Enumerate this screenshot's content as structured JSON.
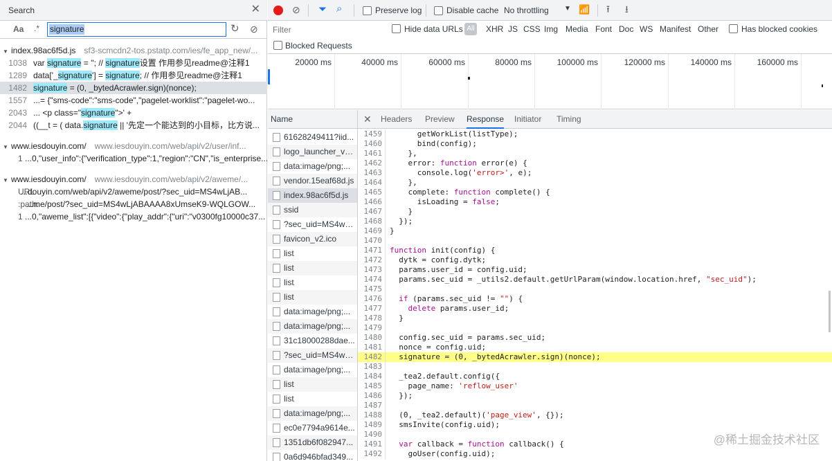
{
  "search_panel": {
    "tab_label": "Search",
    "aa_label": "Aa",
    "regex_label": ".*",
    "query": "signature",
    "results": [
      {
        "file": "index.98ac6f5d.js",
        "path": "sf3-scmcdn2-tos.pstatp.com/ies/fe_app_new/...",
        "lines": [
          {
            "num": "1038",
            "pre": "var ",
            "hl1": "signature",
            "mid": " = ''; // ",
            "hl2": "signature",
            "post": "设置 作用参见readme@注释1"
          },
          {
            "num": "1289",
            "pre": "data['_",
            "hl1": "signature",
            "mid": "'] = ",
            "hl2": "signature",
            "post": "; // 作用参见readme@注释1"
          },
          {
            "num": "1482",
            "pre": "",
            "hl1": "signature",
            "mid": " = (0, _bytedAcrawler.sign)(nonce);",
            "hl2": "",
            "post": ""
          },
          {
            "num": "1557",
            "pre": "...= {\"sms-code\":\"sms-code\",\"pagelet-worklist\":\"pagelet-wo...",
            "hl1": "",
            "mid": "",
            "hl2": "",
            "post": ""
          },
          {
            "num": "2043",
            "pre": "...         <p class=\"",
            "hl1": "signature",
            "mid": "\">' +",
            "hl2": "",
            "post": ""
          },
          {
            "num": "2044",
            "pre": "((__t = ( data.",
            "hl1": "signature",
            "mid": " || '先定一个能达到的小目标，比方说...",
            "hl2": "",
            "post": ""
          }
        ]
      },
      {
        "file": "www.iesdouyin.com/",
        "path": "www.iesdouyin.com/web/api/v2/user/inf...",
        "lines": [
          {
            "num": "1",
            "text": "...0,\"user_info\":{\"verification_type\":1,\"region\":\"CN\",\"is_enterprise..."
          }
        ]
      },
      {
        "file": "www.iesdouyin.com/",
        "path": "www.iesdouyin.com/web/api/v2/aweme/...",
        "lines": [
          {
            "num": "URL",
            "text": "...douyin.com/web/api/v2/aweme/post/?sec_uid=MS4wLjAB..."
          },
          {
            "num": ":path:",
            "text": "...me/post/?sec_uid=MS4wLjABAAAA8xUmseK9-WQLGOW..."
          },
          {
            "num": "1",
            "text": "...0,\"aweme_list\":[{\"video\":{\"play_addr\":{\"uri\":\"v0300fg10000c37..."
          }
        ]
      }
    ]
  },
  "toolbar": {
    "preserve_log": "Preserve log",
    "disable_cache": "Disable cache",
    "throttling": "No throttling"
  },
  "filter_bar": {
    "placeholder": "Filter",
    "hide_data_urls": "Hide data URLs",
    "all_label": "All",
    "types": [
      "XHR",
      "JS",
      "CSS",
      "Img",
      "Media",
      "Font",
      "Doc",
      "WS",
      "Manifest",
      "Other"
    ],
    "blocked_cookies": "Has blocked cookies",
    "blocked_requests": "Blocked Requests"
  },
  "overview": {
    "ticks": [
      "20000 ms",
      "40000 ms",
      "60000 ms",
      "80000 ms",
      "100000 ms",
      "120000 ms",
      "140000 ms",
      "160000 ms"
    ]
  },
  "requests": {
    "header": "Name",
    "items": [
      "61628249411?iid...",
      "logo_launcher_v2...",
      "data:image/png;...",
      "vendor.15eaf68d.js",
      "index.98ac6f5d.js",
      "ssid",
      "?sec_uid=MS4wL...",
      "favicon_v2.ico",
      "list",
      "list",
      "list",
      "list",
      "data:image/png;...",
      "data:image/png;...",
      "31c18000288dae...",
      "?sec_uid=MS4wL...",
      "data:image/png;...",
      "list",
      "list",
      "data:image/png;...",
      "ec0e7794a9614e...",
      "1351db6f082947...",
      "0a6d946bfad349..."
    ],
    "selected_index": 4
  },
  "detail": {
    "tabs": [
      "Headers",
      "Preview",
      "Response",
      "Initiator",
      "Timing"
    ],
    "active_tab": "Response",
    "code_lines": [
      {
        "n": "1459",
        "t": "      getWorkList(listType);"
      },
      {
        "n": "1460",
        "t": "      bind(config);"
      },
      {
        "n": "1461",
        "t": "    },"
      },
      {
        "n": "1462",
        "t": "    error: function error(e) {"
      },
      {
        "n": "1463",
        "t": "      console.log('error>', e);"
      },
      {
        "n": "1464",
        "t": "    },"
      },
      {
        "n": "1465",
        "t": "    complete: function complete() {"
      },
      {
        "n": "1466",
        "t": "      isLoading = false;"
      },
      {
        "n": "1467",
        "t": "    }"
      },
      {
        "n": "1468",
        "t": "  });"
      },
      {
        "n": "1469",
        "t": "}"
      },
      {
        "n": "1470",
        "t": ""
      },
      {
        "n": "1471",
        "t": "function init(config) {"
      },
      {
        "n": "1472",
        "t": "  dytk = config.dytk;"
      },
      {
        "n": "1473",
        "t": "  params.user_id = config.uid;"
      },
      {
        "n": "1474",
        "t": "  params.sec_uid = _utils2.default.getUrlParam(window.location.href, \"sec_uid\");"
      },
      {
        "n": "1475",
        "t": ""
      },
      {
        "n": "1476",
        "t": "  if (params.sec_uid != \"\") {"
      },
      {
        "n": "1477",
        "t": "    delete params.user_id;"
      },
      {
        "n": "1478",
        "t": "  }"
      },
      {
        "n": "1479",
        "t": ""
      },
      {
        "n": "1480",
        "t": "  config.sec_uid = params.sec_uid;"
      },
      {
        "n": "1481",
        "t": "  nonce = config.uid;"
      },
      {
        "n": "1482",
        "t": "  signature = (0, _bytedAcrawler.sign)(nonce);"
      },
      {
        "n": "1483",
        "t": ""
      },
      {
        "n": "1484",
        "t": "  _tea2.default.config({"
      },
      {
        "n": "1485",
        "t": "    page_name: 'reflow_user'"
      },
      {
        "n": "1486",
        "t": "  });"
      },
      {
        "n": "1487",
        "t": ""
      },
      {
        "n": "1488",
        "t": "  (0, _tea2.default)('page_view', {});"
      },
      {
        "n": "1489",
        "t": "  smsInvite(config.uid);"
      },
      {
        "n": "1490",
        "t": ""
      },
      {
        "n": "1491",
        "t": "  var callback = function callback() {"
      },
      {
        "n": "1492",
        "t": "    goUser(config.uid);"
      }
    ],
    "highlight_line": "1482"
  },
  "watermark": "@稀土掘金技术社区"
}
